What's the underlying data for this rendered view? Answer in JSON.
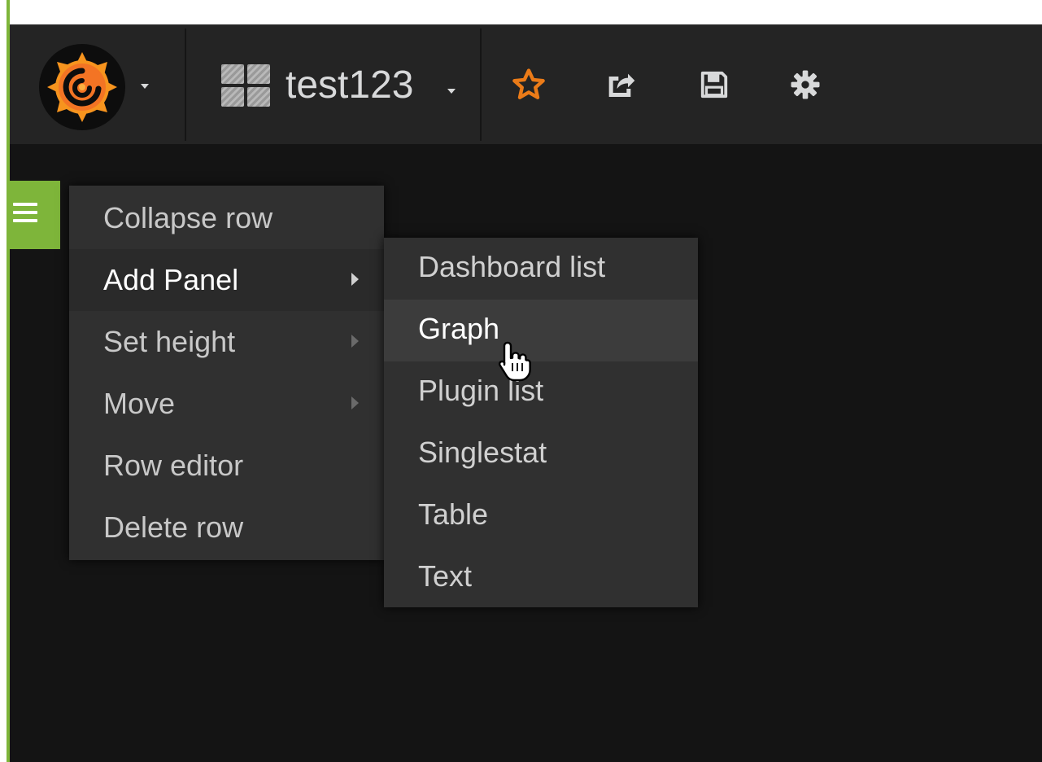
{
  "navbar": {
    "logo_icon": "grafana-logo-icon",
    "dashboard_title": "test123",
    "dashboard_icon": "dashboard-grid-icon",
    "actions": {
      "star_icon": "star-icon",
      "share_icon": "share-icon",
      "save_icon": "save-icon",
      "settings_icon": "gear-icon"
    }
  },
  "colors": {
    "accent_green": "#7eb53a",
    "star_orange": "#eb7b18",
    "navbar_bg": "#242424",
    "canvas_bg": "#141414",
    "menu_bg": "#303030"
  },
  "row_menu": {
    "items": [
      {
        "label": "Collapse row"
      },
      {
        "label": "Add Panel"
      },
      {
        "label": "Set height"
      },
      {
        "label": "Move"
      },
      {
        "label": "Row editor"
      },
      {
        "label": "Delete row"
      }
    ]
  },
  "add_panel_submenu": {
    "items": [
      {
        "label": "Dashboard list"
      },
      {
        "label": "Graph"
      },
      {
        "label": "Plugin list"
      },
      {
        "label": "Singlestat"
      },
      {
        "label": "Table"
      },
      {
        "label": "Text"
      }
    ]
  }
}
